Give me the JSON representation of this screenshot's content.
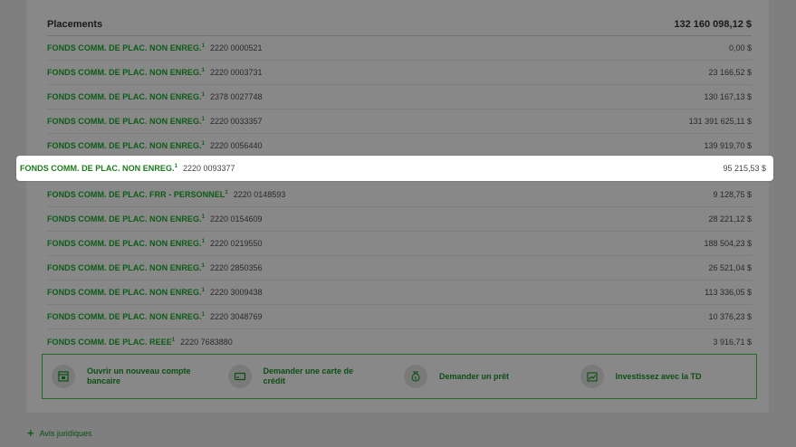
{
  "header": {
    "title": "Placements",
    "total": "132 160 098,12 $"
  },
  "rows": [
    {
      "fund": "FONDS COMM. DE PLAC. NON ENREG.",
      "sup": "1",
      "number": "2220 0000521",
      "amount": "0,00 $"
    },
    {
      "fund": "FONDS COMM. DE PLAC. NON ENREG.",
      "sup": "1",
      "number": "2220 0003731",
      "amount": "23 166,52 $"
    },
    {
      "fund": "FONDS COMM. DE PLAC. NON ENREG.",
      "sup": "1",
      "number": "2378 0027748",
      "amount": "130 167,13 $"
    },
    {
      "fund": "FONDS COMM. DE PLAC. NON ENREG.",
      "sup": "1",
      "number": "2220 0033357",
      "amount": "131 391 625,11 $"
    },
    {
      "fund": "FONDS COMM. DE PLAC. NON ENREG.",
      "sup": "1",
      "number": "2220 0056440",
      "amount": "139 919,70 $"
    },
    {
      "fund": "FONDS COMM. DE PLAC. NON ENREG.",
      "sup": "1",
      "number": "2220 0093377",
      "amount": "95 215,53 $"
    },
    {
      "fund": "FONDS COMM. DE PLAC. FRR - PERSONNEL",
      "sup": "1",
      "number": "2220 0148593",
      "amount": "9 128,75 $"
    },
    {
      "fund": "FONDS COMM. DE PLAC. NON ENREG.",
      "sup": "1",
      "number": "2220 0154609",
      "amount": "28 221,12 $"
    },
    {
      "fund": "FONDS COMM. DE PLAC. NON ENREG.",
      "sup": "1",
      "number": "2220 0219550",
      "amount": "188 504,23 $"
    },
    {
      "fund": "FONDS COMM. DE PLAC. NON ENREG.",
      "sup": "1",
      "number": "2220 2850356",
      "amount": "26 521,04 $"
    },
    {
      "fund": "FONDS COMM. DE PLAC. NON ENREG.",
      "sup": "1",
      "number": "2220 3009438",
      "amount": "113 336,05 $"
    },
    {
      "fund": "FONDS COMM. DE PLAC. NON ENREG.",
      "sup": "1",
      "number": "2220 3048769",
      "amount": "10 376,23 $"
    },
    {
      "fund": "FONDS COMM. DE PLAC. REEE",
      "sup": "1",
      "number": "2220 7683880",
      "amount": "3 916,71 $"
    }
  ],
  "actions": [
    {
      "label": "Ouvrir un nouveau compte bancaire",
      "icon": "bank-account-icon"
    },
    {
      "label": "Demander une carte de crédit",
      "icon": "credit-card-icon"
    },
    {
      "label": "Demander un prêt",
      "icon": "money-bag-icon"
    },
    {
      "label": "Investissez avec la TD",
      "icon": "investment-chart-icon"
    }
  ],
  "legal": {
    "plus": "+",
    "label": "Avis juridiques"
  },
  "colors": {
    "brand_green": "#0b5c16",
    "overlay_gray": "#7f7f7f",
    "highlight_bg": "#ffffff"
  }
}
